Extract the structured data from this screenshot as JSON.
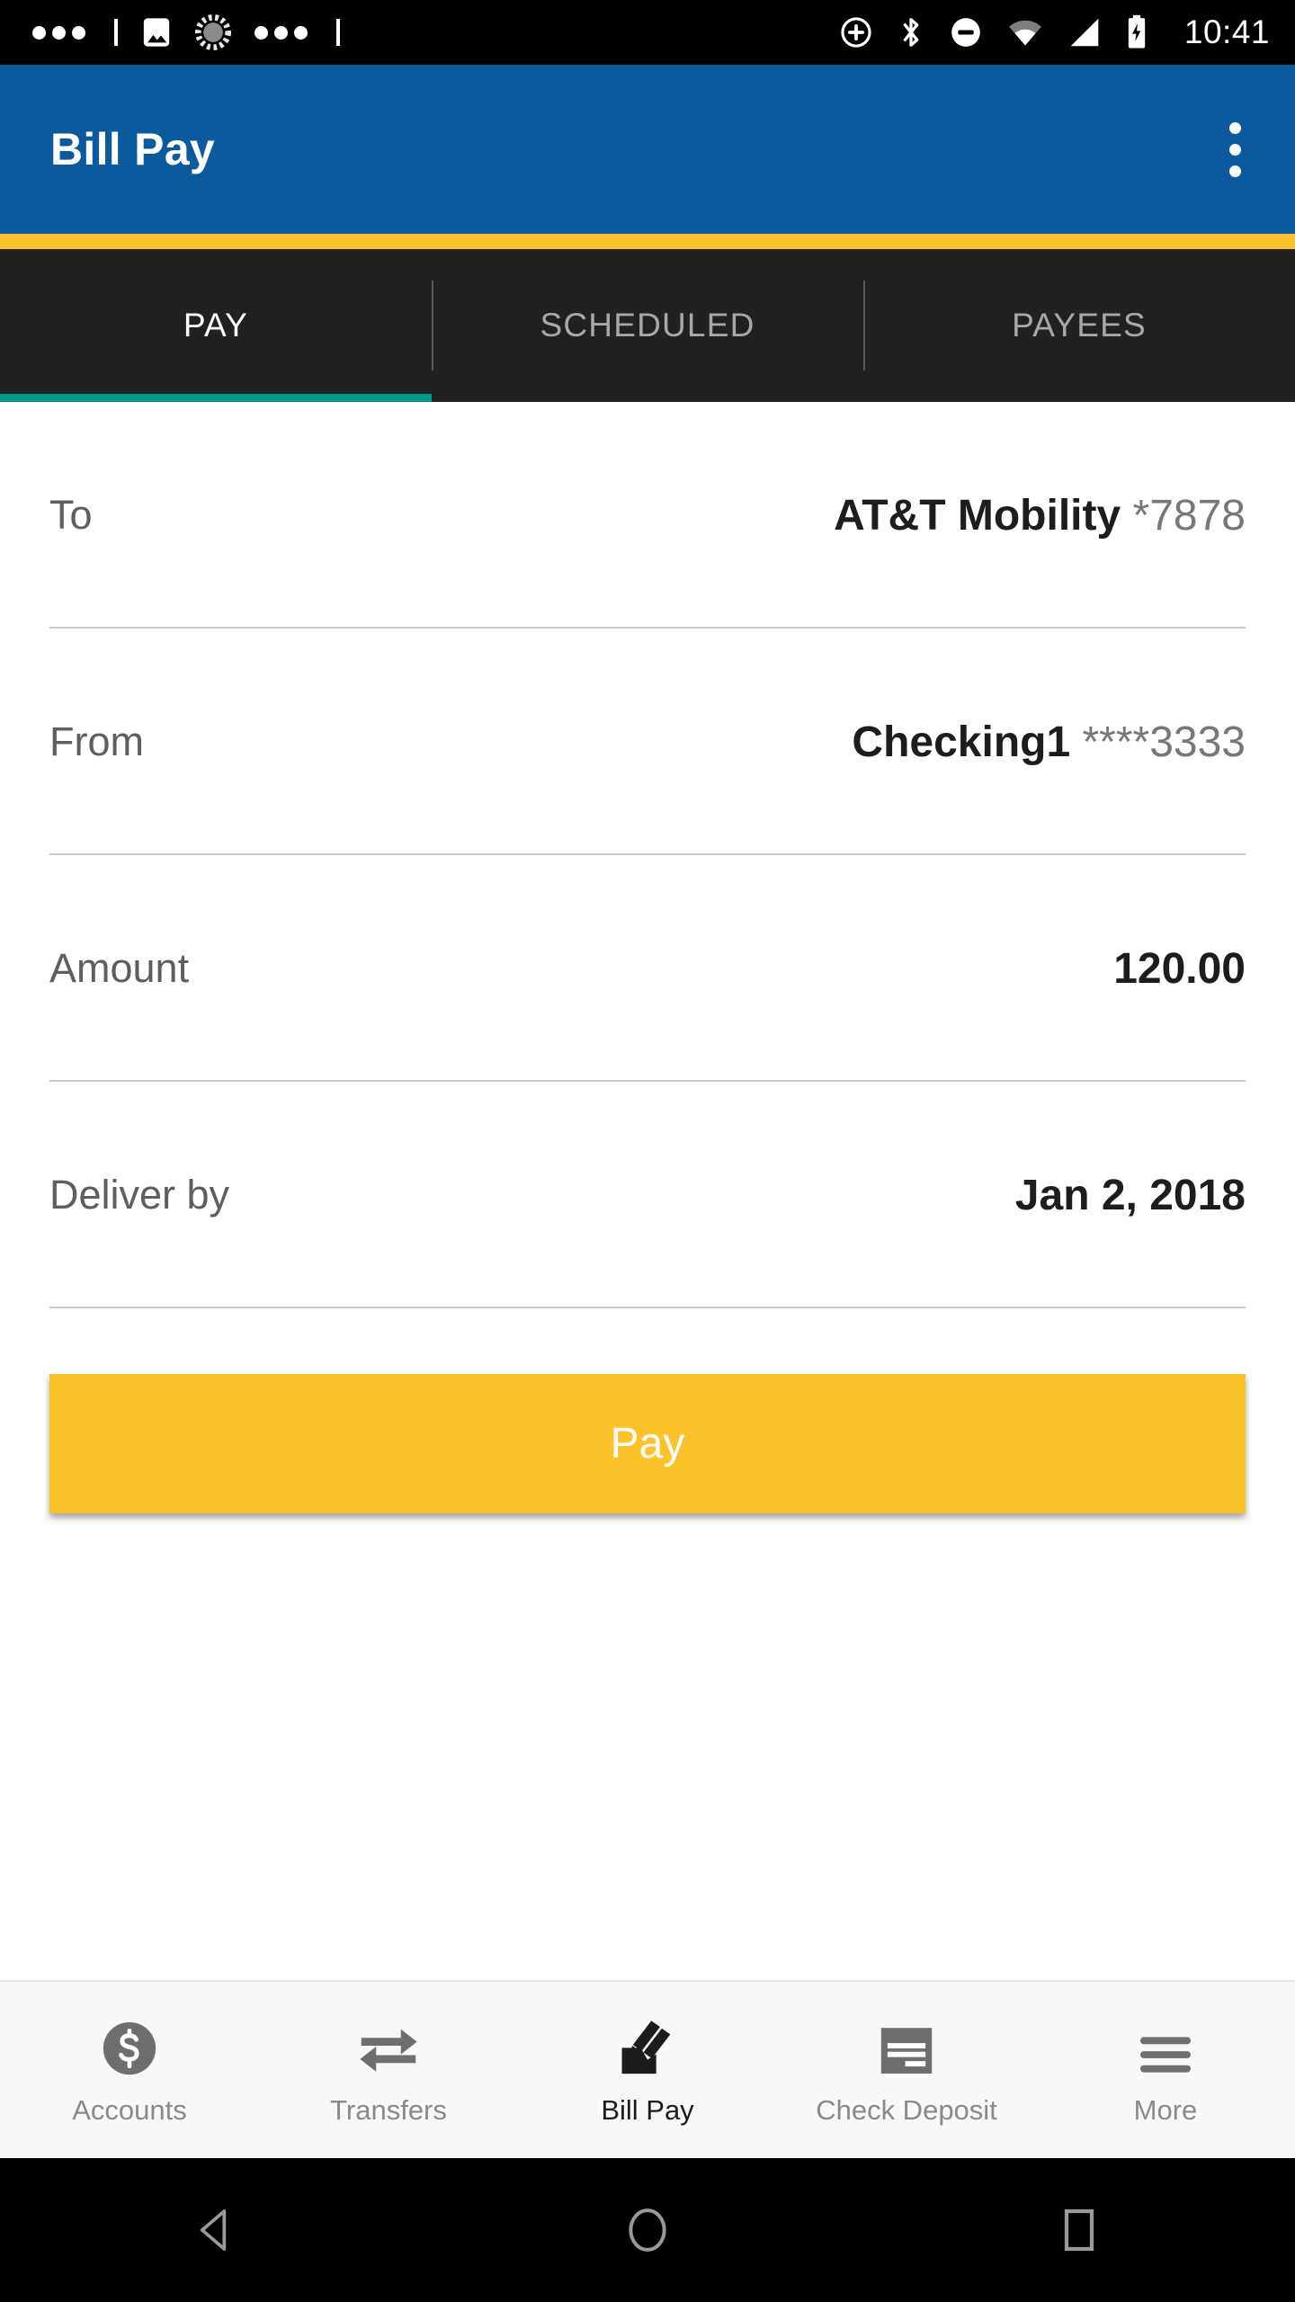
{
  "status_bar": {
    "time": "10:41",
    "left_icons": [
      "dots-icon",
      "image-icon",
      "sync-spinner-icon",
      "dots-icon"
    ],
    "right_icons": [
      "circle-plus-icon",
      "bluetooth-icon",
      "do-not-disturb-icon",
      "wifi-icon",
      "cellular-signal-icon",
      "battery-charging-icon"
    ]
  },
  "app_bar": {
    "title": "Bill Pay",
    "overflow_label": "More options",
    "background_color": "#0b5a9e",
    "accent_color": "#fcc22a"
  },
  "tabs": {
    "items": [
      {
        "label": "PAY",
        "active": true
      },
      {
        "label": "SCHEDULED",
        "active": false
      },
      {
        "label": "PAYEES",
        "active": false
      }
    ],
    "indicator_color": "#009688",
    "background_color": "#212121"
  },
  "form": {
    "rows": [
      {
        "label": "To",
        "value": "AT&T Mobility",
        "mask": "*7878"
      },
      {
        "label": "From",
        "value": "Checking1",
        "mask": "****3333"
      },
      {
        "label": "Amount",
        "value": "120.00",
        "mask": ""
      },
      {
        "label": "Deliver by",
        "value": "Jan 2, 2018",
        "mask": ""
      }
    ]
  },
  "primary_action": {
    "label": "Pay",
    "background_color": "#fcc22a",
    "text_color": "#ffffff"
  },
  "bottom_nav": {
    "items": [
      {
        "label": "Accounts",
        "icon": "dollar-circle-icon",
        "active": false
      },
      {
        "label": "Transfers",
        "icon": "transfer-arrows-icon",
        "active": false
      },
      {
        "label": "Bill Pay",
        "icon": "envelope-pen-icon",
        "active": true
      },
      {
        "label": "Check Deposit",
        "icon": "check-document-icon",
        "active": false
      },
      {
        "label": "More",
        "icon": "hamburger-icon",
        "active": false
      }
    ]
  },
  "android_nav": {
    "back_label": "Back",
    "home_label": "Home",
    "recents_label": "Recents"
  }
}
